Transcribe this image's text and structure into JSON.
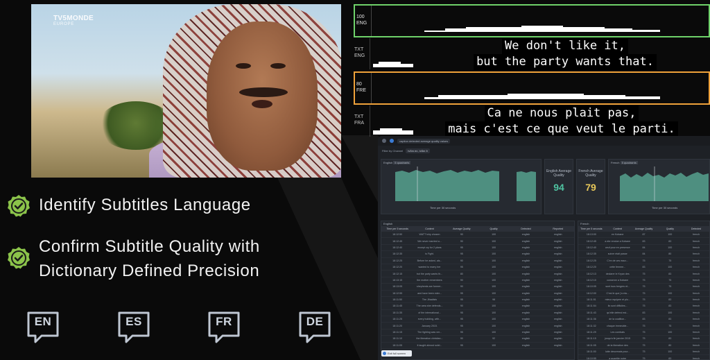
{
  "video": {
    "logo_line1": "TV5MONDE",
    "logo_line2": "EUROPE"
  },
  "features": [
    {
      "text": "Identify Subtitles Language"
    },
    {
      "text": "Confirm Subtitle Quality with Dictionary Defined Precision"
    }
  ],
  "languages": [
    "EN",
    "ES",
    "FR",
    "DE"
  ],
  "tracks": {
    "english": {
      "score": "100",
      "code": "ENG",
      "border_color": "#6fd36a",
      "txt_label": "TXT",
      "txt_code": "ENG",
      "subtitle_line1": "We don't like it,",
      "subtitle_line2": "but the party wants that."
    },
    "french": {
      "score": "80",
      "code": "FRE",
      "border_color": "#f0a23a",
      "txt_label": "TXT",
      "txt_code": "FRA",
      "subtitle_line1": "Ca ne nous plait pas,",
      "subtitle_line2": "mais c'est ce que veut le parti."
    }
  },
  "dashboard": {
    "tab_title": "caption detected average quality values",
    "filter_label": "Filter by Channel",
    "filter_value": "tv5m en, tv5m fr",
    "english_chart_title": "English",
    "french_chart_title": "French",
    "chip_label": "5 quadrants",
    "x_axis_label": "Time per 30 seconds",
    "english_metric_label": "English Average Quality",
    "english_metric_value": "94",
    "french_metric_label": "French Average Quality",
    "french_metric_value": "79",
    "english_table_title": "English",
    "french_table_title": "French",
    "english_columns": [
      "Time per 5 seconds",
      "Content",
      "Average Quality",
      "Quality",
      "Detected",
      "Reported"
    ],
    "french_columns": [
      "Time per 5 seconds",
      "Content",
      "Average Quality",
      "Quality",
      "Detected"
    ],
    "english_rows": [
      [
        "18:12:50",
        "WATT tchy chosen",
        "90",
        "100",
        "english",
        "english"
      ],
      [
        "18:12:45",
        "We never married a...",
        "90",
        "100",
        "english",
        "english"
      ],
      [
        "18:12:40",
        "except cry for 2 plans",
        "95",
        "100",
        "english",
        "english"
      ],
      [
        "18:12:35",
        "is Fight.",
        "95",
        "100",
        "english",
        "english"
      ],
      [
        "18:12:25",
        "Before he asked, als...",
        "90",
        "100",
        "english",
        "english"
      ],
      [
        "18:12:20",
        "wanted to marry her",
        "95",
        "100",
        "english",
        "english"
      ],
      [
        "18:12:15",
        "but the party wants th...",
        "80",
        "100",
        "english",
        "english"
      ],
      [
        "18:13:15",
        "the mother remembers",
        "90",
        "100",
        "english",
        "english"
      ],
      [
        "18:13:05",
        "shepherds are former...",
        "90",
        "100",
        "english",
        "english"
      ],
      [
        "18:12:55",
        "and have been eder...",
        "95",
        "100",
        "english",
        "english"
      ],
      [
        "18:11:50",
        "The Jihadists",
        "95",
        "98",
        "english",
        "english"
      ],
      [
        "18:11:45",
        "The area she defends...",
        "90",
        "100",
        "english",
        "english"
      ],
      [
        "18:11:35",
        "of the international...",
        "95",
        "100",
        "english",
        "english"
      ],
      [
        "18:11:25",
        "every building, with...",
        "95",
        "100",
        "english",
        "english"
      ],
      [
        "18:11:20",
        "January 2015.",
        "95",
        "100",
        "english",
        "english"
      ],
      [
        "18:11:15",
        "The fighting was ver...",
        "95",
        "100",
        "english",
        "english"
      ],
      [
        "18:11:10",
        "the liberation christian...",
        "90",
        "92",
        "english",
        "english"
      ],
      [
        "18:11:05",
        "it taught almost solel...",
        "95",
        "100",
        "english",
        "english"
      ]
    ],
    "french_rows": [
      [
        "18:13:00",
        "en Kobane",
        "87",
        "100",
        "french"
      ],
      [
        "18:12:45",
        "a ete rendue a Kobane",
        "83",
        "83",
        "french"
      ],
      [
        "18:12:40",
        "ceuf pour en presence",
        "84",
        "100",
        "french"
      ],
      [
        "18:12:35",
        "suivre etait passe",
        "84",
        "80",
        "french"
      ],
      [
        "18:12:25",
        "C'en de ces eaux...",
        "75",
        "75",
        "french"
      ],
      [
        "18:12:20",
        "cette femme...",
        "83",
        "100",
        "french"
      ],
      [
        "18:12:13",
        "declarer le Kryan des",
        "75",
        "83",
        "french"
      ],
      [
        "18:12:10",
        "conserve a Kobane",
        "75",
        "75",
        "french"
      ],
      [
        "18:10:05",
        "sont tous bergers et...",
        "75",
        "75",
        "french"
      ],
      [
        "18:12:00",
        "C'est le que j'a eta...",
        "75",
        "100",
        "french"
      ],
      [
        "18:11:51",
        "mieux equipee et plu...",
        "75",
        "83",
        "french"
      ],
      [
        "18:11:54",
        "ils sont difficiles...",
        "75",
        "83",
        "french"
      ],
      [
        "18:11:43",
        "qu'elle defend est...",
        "83",
        "100",
        "french"
      ],
      [
        "18:11:36",
        "de la coalition...",
        "83",
        "83",
        "french"
      ],
      [
        "18:11:32",
        "chaque immeuble...",
        "75",
        "75",
        "french"
      ],
      [
        "18:11:29",
        "Les combats",
        "75",
        "100",
        "french"
      ],
      [
        "18:11:15",
        "jusqu'a fin janvier 2015",
        "75",
        "83",
        "french"
      ],
      [
        "18:11:05",
        "de la liberation des",
        "75",
        "80",
        "french"
      ],
      [
        "18:11:00",
        "lutte desormais pour...",
        "75",
        "100",
        "french"
      ],
      [
        "18:10:55",
        "a quantite notre",
        "75",
        "83",
        "french"
      ]
    ],
    "toast_text": "Exit full screen"
  },
  "colors": {
    "accent_green": "#6fd36a",
    "accent_orange": "#f0a23a",
    "chart_fill": "#4e8f80",
    "english_metric": "#4fc3a1",
    "french_metric": "#e8c85a",
    "check_green": "#8bc34a"
  }
}
